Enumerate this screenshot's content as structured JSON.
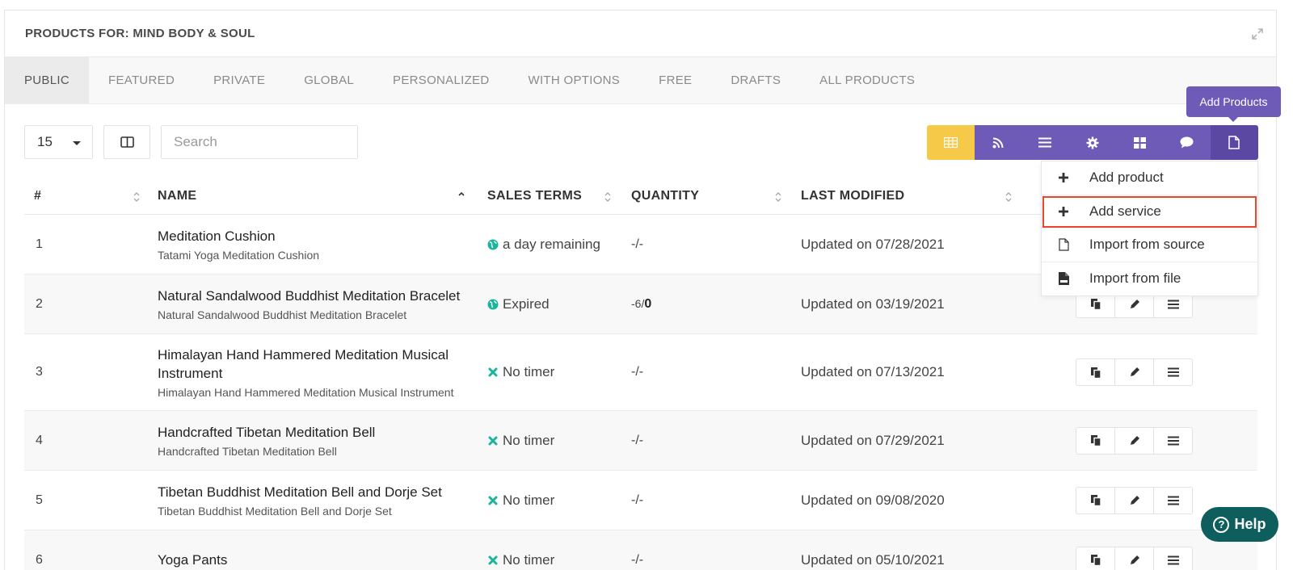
{
  "panel": {
    "title": "PRODUCTS FOR: MIND BODY & SOUL"
  },
  "tabs": [
    {
      "label": "PUBLIC",
      "active": true
    },
    {
      "label": "FEATURED"
    },
    {
      "label": "PRIVATE"
    },
    {
      "label": "GLOBAL"
    },
    {
      "label": "PERSONALIZED"
    },
    {
      "label": "WITH OPTIONS"
    },
    {
      "label": "FREE"
    },
    {
      "label": "DRAFTS"
    },
    {
      "label": "ALL PRODUCTS"
    }
  ],
  "toolbar": {
    "page_size": "15",
    "search_placeholder": "Search"
  },
  "viewbar": {
    "tooltip": "Add Products",
    "buttons": [
      "grid-view-icon",
      "rss-icon",
      "list-icon",
      "gear-icon",
      "tiles-icon",
      "comment-icon",
      "document-icon"
    ],
    "colors": {
      "grid": "#f7c948",
      "purple": "#6e5bb7",
      "active": "#5a48a3"
    }
  },
  "columns": {
    "num": "#",
    "name": "NAME",
    "terms": "SALES TERMS",
    "qty": "QUANTITY",
    "modified": "LAST MODIFIED"
  },
  "rows": [
    {
      "num": "1",
      "name": "Meditation Cushion",
      "sub": "Tatami Yoga Meditation Cushion",
      "terms": "a day remaining",
      "terms_icon": "globe-icon",
      "qty": "-/-",
      "modified": "Updated on 07/28/2021"
    },
    {
      "num": "2",
      "name": "Natural Sandalwood Buddhist Meditation Bracelet",
      "sub": "Natural Sandalwood Buddhist Meditation Bracelet",
      "terms": "Expired",
      "terms_icon": "globe-icon",
      "qty_neg": "-6/",
      "qty_bold": "0",
      "modified": "Updated on 03/19/2021"
    },
    {
      "num": "3",
      "name": "Himalayan Hand Hammered Meditation Musical Instrument",
      "sub": "Himalayan Hand Hammered Meditation Musical Instrument",
      "terms": "No timer",
      "terms_icon": "x-icon",
      "qty": "-/-",
      "modified": "Updated on 07/13/2021"
    },
    {
      "num": "4",
      "name": "Handcrafted Tibetan Meditation Bell",
      "sub": "Handcrafted Tibetan Meditation Bell",
      "terms": "No timer",
      "terms_icon": "x-icon",
      "qty": "-/-",
      "modified": "Updated on 07/29/2021"
    },
    {
      "num": "5",
      "name": "Tibetan Buddhist Meditation Bell and Dorje Set",
      "sub": "Tibetan Buddhist Meditation Bell and Dorje Set",
      "terms": "No timer",
      "terms_icon": "x-icon",
      "qty": "-/-",
      "modified": "Updated on 09/08/2020"
    },
    {
      "num": "6",
      "name": "Yoga Pants",
      "sub": "",
      "terms": "No timer",
      "terms_icon": "x-icon",
      "qty": "-/-",
      "modified": "Updated on 05/10/2021"
    }
  ],
  "dropdown": [
    {
      "label": "Add product",
      "icon": "plus-icon"
    },
    {
      "label": "Add service",
      "icon": "plus-icon",
      "highlighted": true
    },
    {
      "label": "Import from source",
      "icon": "file-outline-icon"
    },
    {
      "label": "Import from file",
      "icon": "csv-file-icon"
    }
  ],
  "help": {
    "label": "Help"
  }
}
